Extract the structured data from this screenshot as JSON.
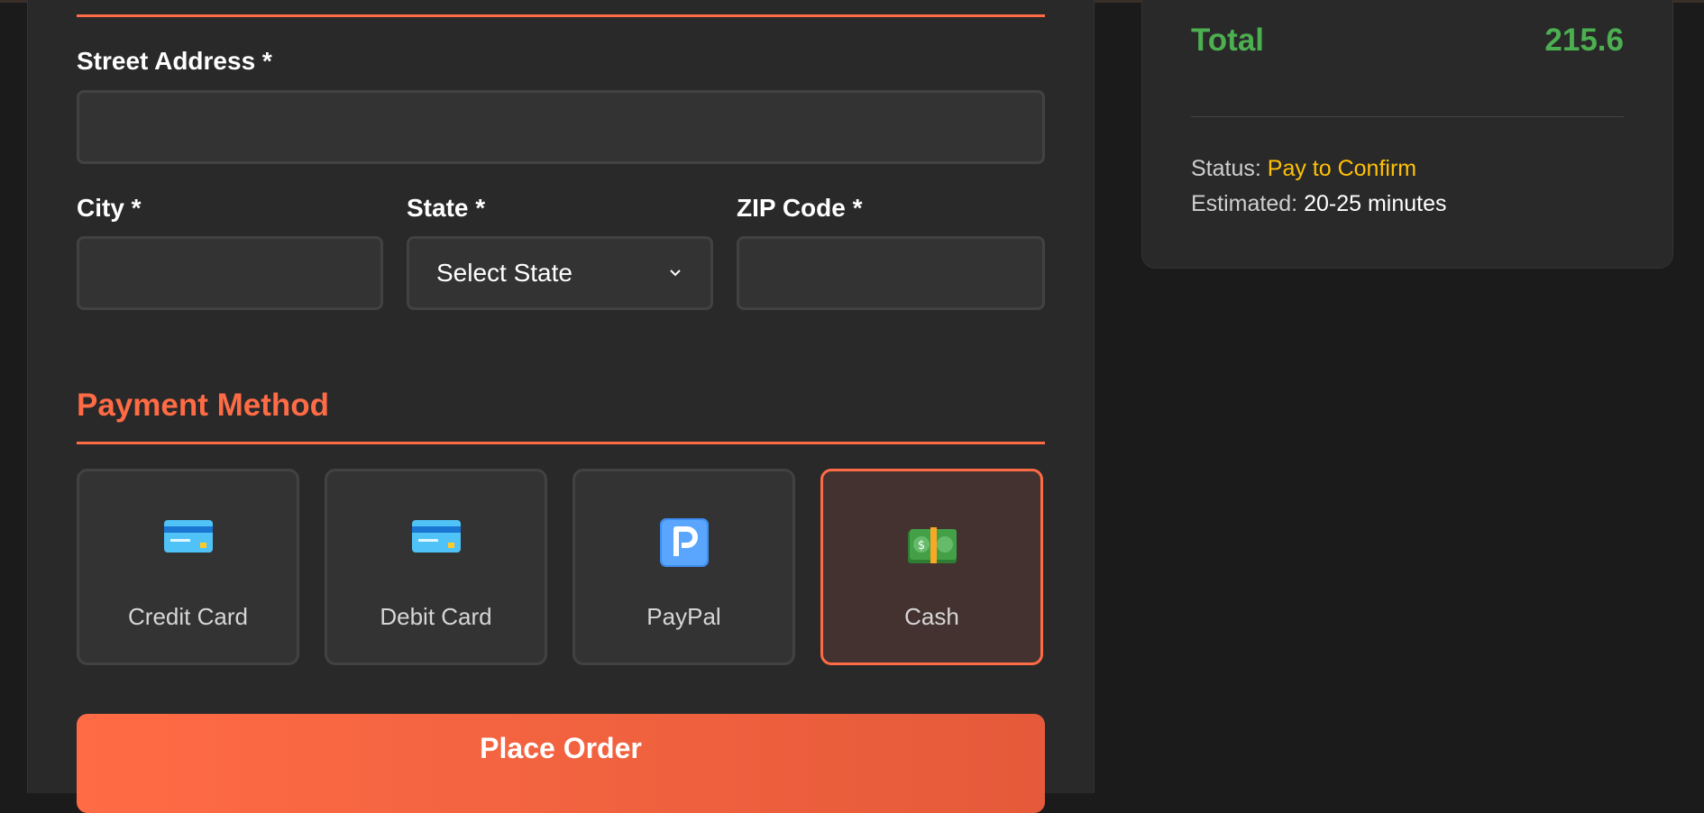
{
  "address": {
    "street_label": "Street Address *",
    "street_value": "",
    "city_label": "City *",
    "city_value": "",
    "state_label": "State *",
    "state_selected": "Select State",
    "zip_label": "ZIP Code *",
    "zip_value": ""
  },
  "payment": {
    "section_title": "Payment Method",
    "options": [
      {
        "label": "Credit Card",
        "icon": "credit-card-icon",
        "selected": false
      },
      {
        "label": "Debit Card",
        "icon": "credit-card-icon",
        "selected": false
      },
      {
        "label": "PayPal",
        "icon": "p-button-icon",
        "selected": false
      },
      {
        "label": "Cash",
        "icon": "dollar-banknote-icon",
        "selected": true
      }
    ]
  },
  "actions": {
    "place_order_label": "Place Order"
  },
  "summary": {
    "total_label": "Total",
    "total_value": "215.6",
    "status_label": "Status:",
    "status_value": "Pay to Confirm",
    "estimated_label": "Estimated:",
    "estimated_value": "20-25 minutes"
  },
  "colors": {
    "accent": "#ff6b45",
    "total_green": "#4caf50",
    "status_yellow": "#ffc107",
    "background": "#1b1b1b",
    "panel": "#292929"
  }
}
